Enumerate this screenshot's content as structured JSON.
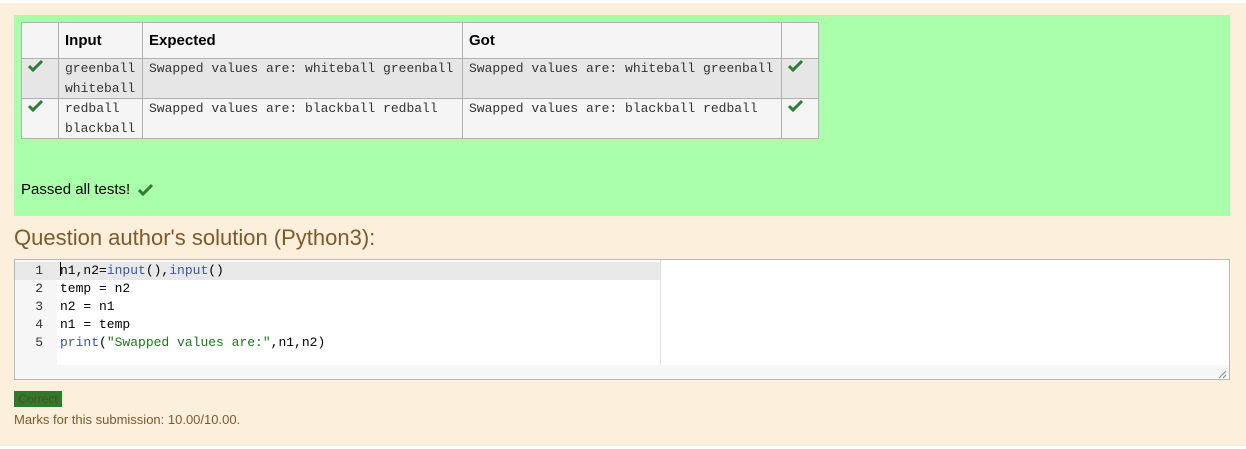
{
  "results_table": {
    "headers": [
      "",
      "Input",
      "Expected",
      "Got",
      ""
    ],
    "rows": [
      {
        "input_lines": [
          "greenball",
          "whiteball"
        ],
        "expected": "Swapped values are: whiteball greenball",
        "got": "Swapped values are: whiteball greenball",
        "status": "pass"
      },
      {
        "input_lines": [
          "redball",
          "blackball"
        ],
        "expected": "Swapped values are: blackball redball",
        "got": "Swapped values are: blackball redball",
        "status": "pass"
      }
    ]
  },
  "passed_message": "Passed all tests!",
  "solution_title": "Question author's solution (Python3):",
  "code_lines": [
    {
      "num": "1",
      "text": "n1,n2=input(),input()"
    },
    {
      "num": "2",
      "text": "temp = n2"
    },
    {
      "num": "3",
      "text": "n2 = n1"
    },
    {
      "num": "4",
      "text": "n1 = temp"
    },
    {
      "num": "5",
      "text": "print(\"Swapped values are:\",n1,n2)"
    }
  ],
  "correct_label": "Correct",
  "marks_text": "Marks for this submission: 10.00/10.00.",
  "colors": {
    "page_bg": "#fcefdc",
    "pass_bg": "#aaffaa",
    "check": "#2e7d32",
    "title": "#7d5a29"
  },
  "icons": {
    "pass_status": "check-icon"
  }
}
